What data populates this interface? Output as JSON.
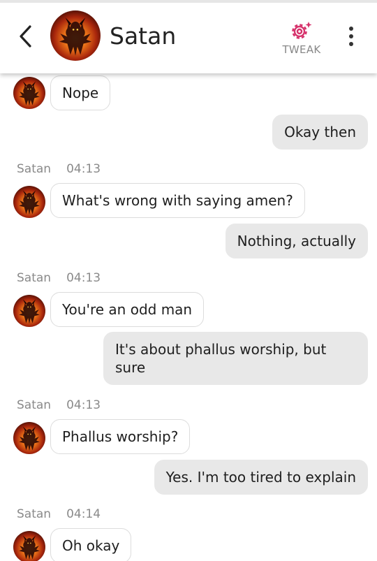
{
  "header": {
    "contact_name": "Satan",
    "tweak_label": "TWEAK",
    "back_icon": "chevron-left-icon",
    "tweak_icon": "gear-sparkle-icon",
    "more_icon": "vertical-dots-icon",
    "accent_color": "#d6336c"
  },
  "messages": [
    {
      "type": "incoming",
      "text": "Nope"
    },
    {
      "type": "outgoing",
      "text": "Okay then"
    },
    {
      "type": "meta",
      "sender": "Satan",
      "time": "04:13"
    },
    {
      "type": "incoming",
      "text": "What's wrong with saying amen?"
    },
    {
      "type": "outgoing",
      "text": "Nothing, actually"
    },
    {
      "type": "meta",
      "sender": "Satan",
      "time": "04:13"
    },
    {
      "type": "incoming",
      "text": "You're an odd man"
    },
    {
      "type": "outgoing",
      "text": "It's about phallus worship, but sure"
    },
    {
      "type": "meta",
      "sender": "Satan",
      "time": "04:13"
    },
    {
      "type": "incoming",
      "text": "Phallus worship?"
    },
    {
      "type": "outgoing",
      "text": "Yes. I'm too tired to explain"
    },
    {
      "type": "meta",
      "sender": "Satan",
      "time": "04:14"
    },
    {
      "type": "incoming",
      "text": "Oh okay"
    }
  ]
}
